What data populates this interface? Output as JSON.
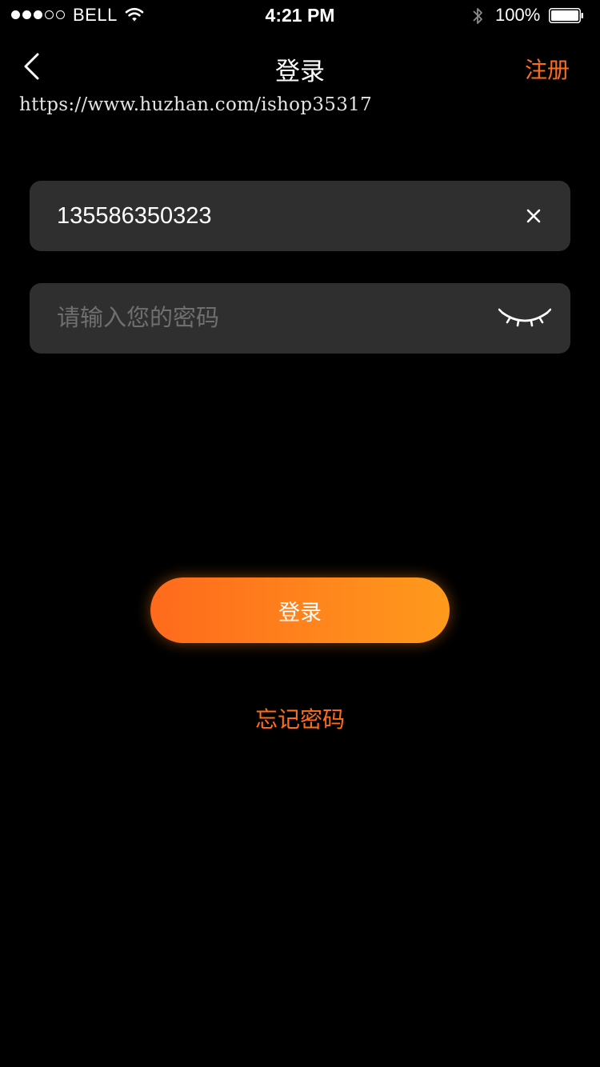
{
  "status_bar": {
    "carrier": "BELL",
    "time": "4:21 PM",
    "battery": "100%",
    "signal_strength": 3,
    "signal_max": 5,
    "icons": [
      "signal-dots-icon",
      "wifi-icon",
      "bluetooth-icon",
      "battery-icon"
    ]
  },
  "nav": {
    "back_icon": "chevron-left-icon",
    "title": "登录",
    "register_label": "注册"
  },
  "watermark": "https://www.huzhan.com/ishop35317",
  "form": {
    "phone_value": "135586350323",
    "clear_icon": "close-icon",
    "password_placeholder": "请输入您的密码",
    "password_toggle_icon": "eye-closed-icon"
  },
  "actions": {
    "login_label": "登录",
    "forgot_label": "忘记密码"
  },
  "colors": {
    "background": "#000000",
    "field_background": "#2f2f2f",
    "accent": "#ff6c1a",
    "button_gradient_start": "#ff6a1c",
    "button_gradient_end": "#ff9a1c",
    "placeholder": "#6f6f6f"
  }
}
